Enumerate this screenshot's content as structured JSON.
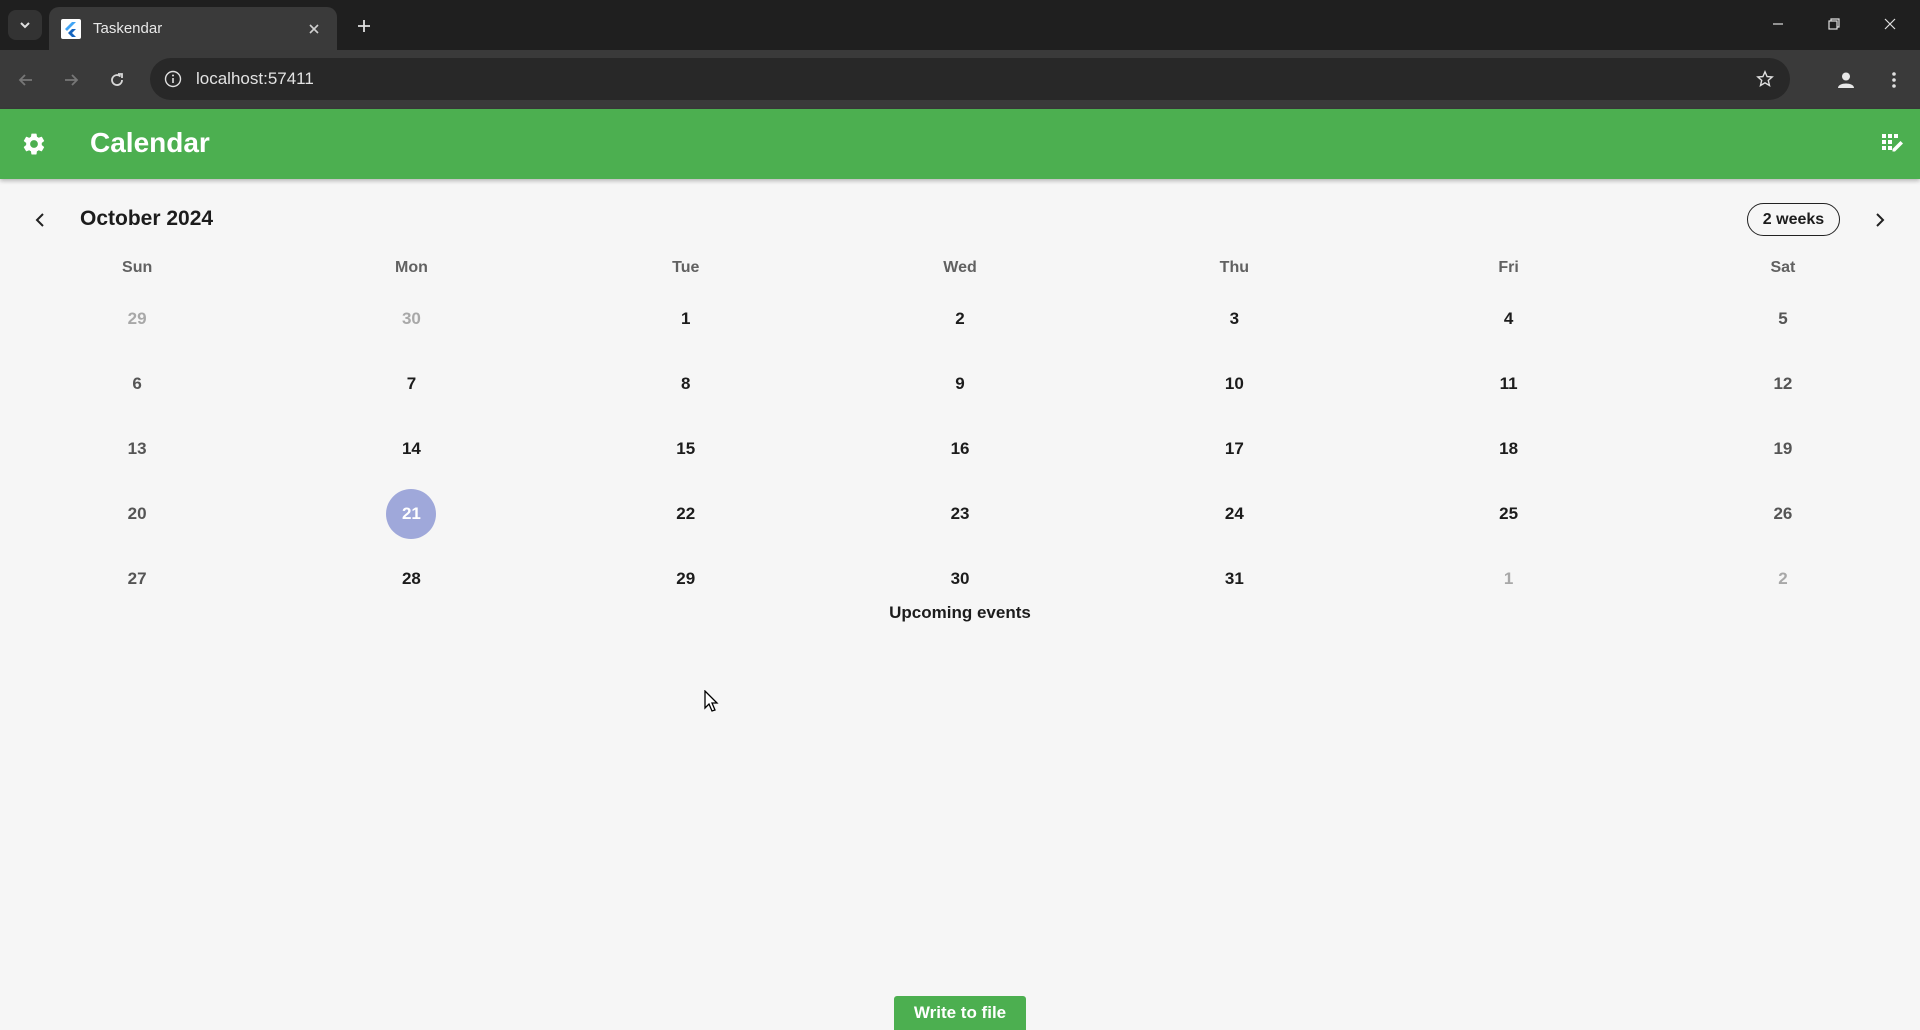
{
  "browser": {
    "tab_title": "Taskendar",
    "url": "localhost:57411"
  },
  "app": {
    "title": "Calendar",
    "accent_color": "#4caf50",
    "today_color": "#9fa8da"
  },
  "calendar": {
    "month_title": "October 2024",
    "format_button": "2 weeks",
    "weekdays": [
      "Sun",
      "Mon",
      "Tue",
      "Wed",
      "Thu",
      "Fri",
      "Sat"
    ],
    "weeks": [
      [
        {
          "d": "29",
          "out": true
        },
        {
          "d": "30",
          "out": true
        },
        {
          "d": "1"
        },
        {
          "d": "2"
        },
        {
          "d": "3"
        },
        {
          "d": "4"
        },
        {
          "d": "5"
        }
      ],
      [
        {
          "d": "6"
        },
        {
          "d": "7"
        },
        {
          "d": "8"
        },
        {
          "d": "9"
        },
        {
          "d": "10"
        },
        {
          "d": "11"
        },
        {
          "d": "12"
        }
      ],
      [
        {
          "d": "13"
        },
        {
          "d": "14"
        },
        {
          "d": "15"
        },
        {
          "d": "16"
        },
        {
          "d": "17"
        },
        {
          "d": "18"
        },
        {
          "d": "19"
        }
      ],
      [
        {
          "d": "20"
        },
        {
          "d": "21",
          "today": true
        },
        {
          "d": "22"
        },
        {
          "d": "23"
        },
        {
          "d": "24"
        },
        {
          "d": "25"
        },
        {
          "d": "26"
        }
      ],
      [
        {
          "d": "27"
        },
        {
          "d": "28"
        },
        {
          "d": "29"
        },
        {
          "d": "30"
        },
        {
          "d": "31"
        },
        {
          "d": "1",
          "out": true
        },
        {
          "d": "2",
          "out": true
        }
      ]
    ]
  },
  "events": {
    "heading": "Upcoming events"
  },
  "actions": {
    "write_button": "Write to file"
  }
}
